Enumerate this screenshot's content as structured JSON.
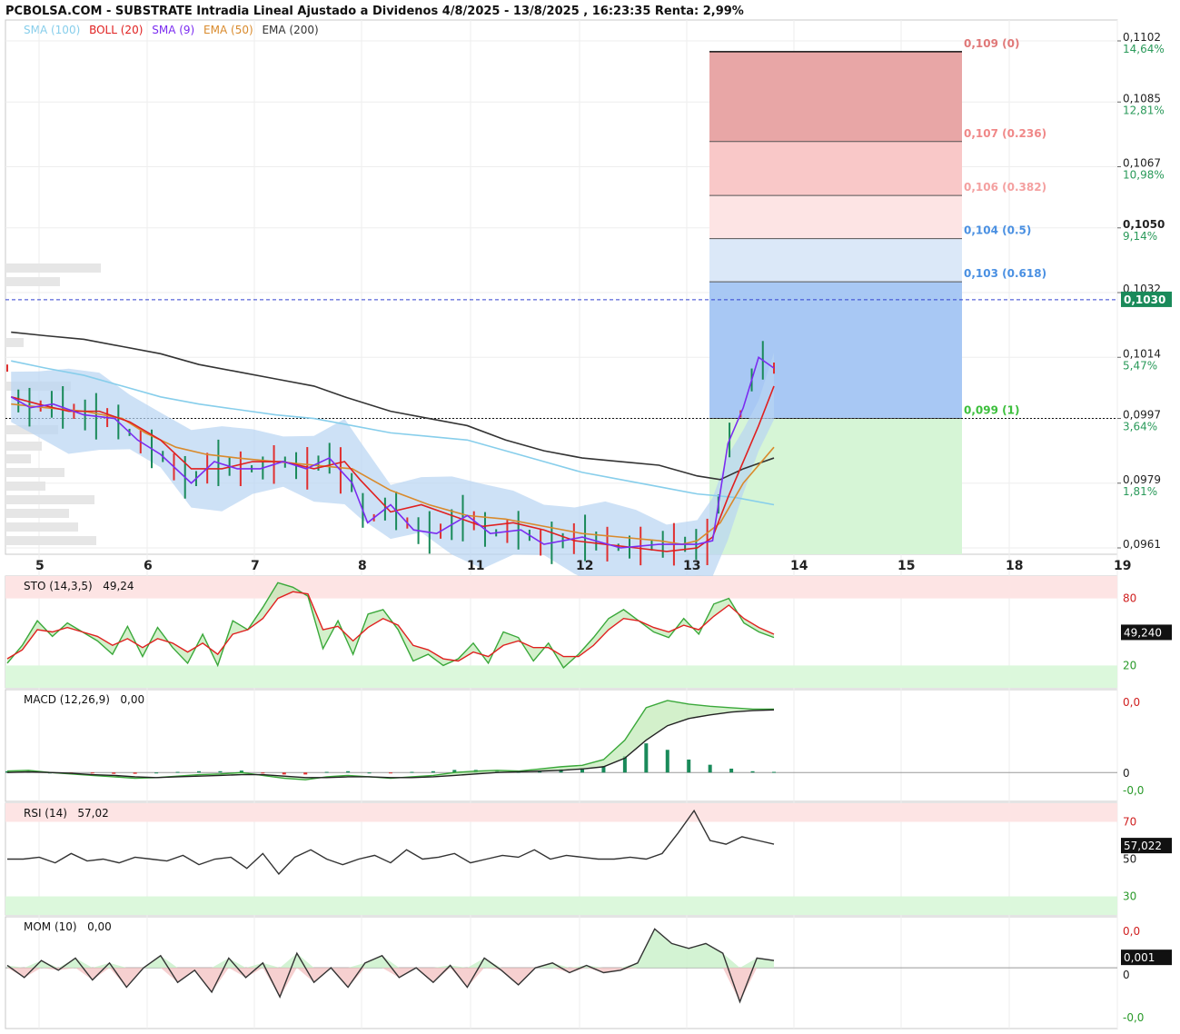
{
  "header": {
    "title": "PCBOLSA.COM - SUBSTRATE Intradia Lineal Ajustado a Dividenos 4/8/2025 - 13/8/2025 , 16:23:35 Renta: 2,99%"
  },
  "legend": [
    {
      "label": "SMA (100)",
      "color": "#87ceeb"
    },
    {
      "label": "BOLL (20)",
      "color": "#e02020"
    },
    {
      "label": "SMA (9)",
      "color": "#7b2cf0"
    },
    {
      "label": "EMA (50)",
      "color": "#d98a2c"
    },
    {
      "label": "EMA (200)",
      "color": "#333333"
    }
  ],
  "colors": {
    "up": "#1a8a5a",
    "down": "#e03030",
    "boll_band": "#b8d4f2",
    "fib_red_dark": "#e8a6a6",
    "fib_red_mid": "#f9c8c8",
    "fib_red_light": "#fde4e4",
    "fib_blue_light": "#dbe8f8",
    "fib_blue_dark": "#a8c8f4",
    "fib_green": "#d6f5d6",
    "price_tag": "#1a8a5a"
  },
  "chart_data": [
    {
      "type": "line",
      "panel": "price",
      "x_ticks": [
        "5",
        "6",
        "7",
        "8",
        "11",
        "12",
        "13",
        "14",
        "15",
        "18",
        "19"
      ],
      "y_ticks": [
        "0,1102",
        "0,1085",
        "0,1067",
        "0,1050",
        "0,1032",
        "0,1014",
        "0,0997",
        "0,0979",
        "0,0961"
      ],
      "y_ticks_bold": "0,1050",
      "pct_ticks": [
        "14,64%",
        "12,81%",
        "10,98%",
        "9,14%",
        "5,47%",
        "3,64%",
        "1,81%"
      ],
      "ylim": [
        0.0961,
        0.1102
      ],
      "last_price": "0,1030",
      "fibonacci": [
        {
          "label": "0,109 (0)",
          "value": 0.1099,
          "color": "#e07878"
        },
        {
          "label": "0,107 (0.236)",
          "value": 0.1074,
          "color": "#f08888"
        },
        {
          "label": "0,106 (0.382)",
          "value": 0.1059,
          "color": "#f4a0a0"
        },
        {
          "label": "0,104 (0.5)",
          "value": 0.1047,
          "color": "#4a90e2"
        },
        {
          "label": "0,103 (0.618)",
          "value": 0.1035,
          "color": "#4a90e2"
        },
        {
          "label": "0,099 (1)",
          "value": 0.0997,
          "color": "#3cbf3c"
        }
      ],
      "series": [
        {
          "name": "SMA (100)",
          "points": [
            [
              0.005,
              0.1013
            ],
            [
              0.05,
              0.1011
            ],
            [
              0.1,
              0.1009
            ],
            [
              0.15,
              0.1006
            ],
            [
              0.2,
              0.1003
            ],
            [
              0.25,
              0.1001
            ],
            [
              0.3,
              0.09995
            ],
            [
              0.35,
              0.0998
            ],
            [
              0.4,
              0.0997
            ],
            [
              0.45,
              0.0995
            ],
            [
              0.5,
              0.0993
            ],
            [
              0.55,
              0.0992
            ],
            [
              0.6,
              0.0991
            ],
            [
              0.65,
              0.0988
            ],
            [
              0.7,
              0.0985
            ],
            [
              0.75,
              0.0982
            ],
            [
              0.8,
              0.098
            ],
            [
              0.85,
              0.0978
            ],
            [
              0.9,
              0.0976
            ],
            [
              0.95,
              0.0975
            ],
            [
              1.0,
              0.0973
            ]
          ]
        },
        {
          "name": "EMA (200)",
          "points": [
            [
              0.005,
              0.1021
            ],
            [
              0.05,
              0.102
            ],
            [
              0.1,
              0.1019
            ],
            [
              0.15,
              0.1017
            ],
            [
              0.2,
              0.1015
            ],
            [
              0.25,
              0.1012
            ],
            [
              0.3,
              0.101
            ],
            [
              0.35,
              0.1008
            ],
            [
              0.4,
              0.1006
            ],
            [
              0.44,
              0.1003
            ],
            [
              0.5,
              0.0999
            ],
            [
              0.55,
              0.0997
            ],
            [
              0.6,
              0.0995
            ],
            [
              0.65,
              0.0991
            ],
            [
              0.7,
              0.0988
            ],
            [
              0.75,
              0.0986
            ],
            [
              0.8,
              0.0985
            ],
            [
              0.85,
              0.0984
            ],
            [
              0.9,
              0.0981
            ],
            [
              0.93,
              0.098
            ],
            [
              0.96,
              0.0983
            ],
            [
              1.0,
              0.0986
            ]
          ]
        },
        {
          "name": "EMA (50)",
          "points": [
            [
              0.005,
              0.1001
            ],
            [
              0.05,
              0.1
            ],
            [
              0.1,
              0.0999
            ],
            [
              0.15,
              0.0997
            ],
            [
              0.18,
              0.0993
            ],
            [
              0.22,
              0.0989
            ],
            [
              0.26,
              0.0987
            ],
            [
              0.3,
              0.0986
            ],
            [
              0.35,
              0.0985
            ],
            [
              0.4,
              0.0984
            ],
            [
              0.45,
              0.0983
            ],
            [
              0.5,
              0.0977
            ],
            [
              0.55,
              0.0973
            ],
            [
              0.6,
              0.097
            ],
            [
              0.65,
              0.0969
            ],
            [
              0.7,
              0.0967
            ],
            [
              0.75,
              0.0965
            ],
            [
              0.8,
              0.0964
            ],
            [
              0.85,
              0.0963
            ],
            [
              0.88,
              0.0962
            ],
            [
              0.9,
              0.0963
            ],
            [
              0.93,
              0.0968
            ],
            [
              0.96,
              0.0979
            ],
            [
              1.0,
              0.0989
            ]
          ]
        },
        {
          "name": "BOLL (20)",
          "points": [
            [
              0.005,
              0.1003
            ],
            [
              0.04,
              0.1001
            ],
            [
              0.08,
              0.0999
            ],
            [
              0.12,
              0.0999
            ],
            [
              0.16,
              0.0996
            ],
            [
              0.2,
              0.0991
            ],
            [
              0.24,
              0.0983
            ],
            [
              0.28,
              0.0983
            ],
            [
              0.32,
              0.0985
            ],
            [
              0.36,
              0.0985
            ],
            [
              0.4,
              0.0983
            ],
            [
              0.44,
              0.0985
            ],
            [
              0.46,
              0.098
            ],
            [
              0.5,
              0.0971
            ],
            [
              0.54,
              0.0973
            ],
            [
              0.58,
              0.097
            ],
            [
              0.62,
              0.0967
            ],
            [
              0.66,
              0.0968
            ],
            [
              0.7,
              0.0966
            ],
            [
              0.74,
              0.0963
            ],
            [
              0.78,
              0.0962
            ],
            [
              0.82,
              0.0961
            ],
            [
              0.86,
              0.096
            ],
            [
              0.9,
              0.0961
            ],
            [
              0.92,
              0.0964
            ],
            [
              0.94,
              0.0975
            ],
            [
              0.96,
              0.0985
            ],
            [
              0.98,
              0.0995
            ],
            [
              1.0,
              0.1006
            ]
          ]
        },
        {
          "name": "SMA (9)",
          "points": [
            [
              0.005,
              0.1003
            ],
            [
              0.03,
              0.1
            ],
            [
              0.06,
              0.1001
            ],
            [
              0.1,
              0.0998
            ],
            [
              0.14,
              0.0997
            ],
            [
              0.17,
              0.0991
            ],
            [
              0.2,
              0.0987
            ],
            [
              0.24,
              0.0979
            ],
            [
              0.27,
              0.0985
            ],
            [
              0.3,
              0.0983
            ],
            [
              0.33,
              0.0983
            ],
            [
              0.36,
              0.0985
            ],
            [
              0.39,
              0.0983
            ],
            [
              0.42,
              0.0986
            ],
            [
              0.45,
              0.0979
            ],
            [
              0.47,
              0.0968
            ],
            [
              0.5,
              0.0973
            ],
            [
              0.53,
              0.0966
            ],
            [
              0.56,
              0.0965
            ],
            [
              0.6,
              0.097
            ],
            [
              0.63,
              0.0965
            ],
            [
              0.67,
              0.0966
            ],
            [
              0.7,
              0.0962
            ],
            [
              0.75,
              0.0964
            ],
            [
              0.8,
              0.0961
            ],
            [
              0.85,
              0.0962
            ],
            [
              0.9,
              0.0962
            ],
            [
              0.92,
              0.0963
            ],
            [
              0.94,
              0.099
            ],
            [
              0.96,
              0.1
            ],
            [
              0.98,
              0.1014
            ],
            [
              1.0,
              0.1011
            ]
          ]
        }
      ]
    },
    {
      "type": "line",
      "panel": "STO",
      "label": "STO (14,3,5)",
      "value": "49,24",
      "last": "49,240",
      "levels": [
        "80",
        "20"
      ],
      "ylim": [
        0,
        100
      ],
      "k": [
        22,
        38,
        60,
        46,
        58,
        50,
        42,
        30,
        55,
        28,
        54,
        36,
        22,
        48,
        20,
        60,
        52,
        72,
        94,
        90,
        82,
        35,
        60,
        30,
        66,
        70,
        52,
        24,
        30,
        20,
        26,
        40,
        22,
        50,
        45,
        24,
        40,
        18,
        30,
        45,
        62,
        70,
        60,
        50,
        45,
        62,
        48,
        75,
        80,
        58,
        50,
        45
      ],
      "d": [
        26,
        34,
        52,
        50,
        54,
        50,
        46,
        38,
        44,
        36,
        44,
        40,
        32,
        40,
        30,
        48,
        52,
        62,
        80,
        86,
        84,
        52,
        55,
        42,
        54,
        62,
        56,
        38,
        34,
        26,
        24,
        32,
        28,
        38,
        42,
        36,
        36,
        28,
        28,
        38,
        52,
        62,
        60,
        54,
        50,
        56,
        52,
        64,
        74,
        62,
        54,
        48
      ]
    },
    {
      "type": "line",
      "panel": "MACD",
      "label": "MACD (12,26,9)",
      "value": "0,00",
      "ticks": [
        "0,0",
        "0",
        "-0,0"
      ],
      "macd": [
        0.02,
        0.03,
        0.0,
        -0.02,
        -0.04,
        -0.06,
        -0.08,
        -0.07,
        -0.05,
        -0.03,
        -0.02,
        0.0,
        -0.04,
        -0.08,
        -0.1,
        -0.06,
        -0.04,
        -0.06,
        -0.08,
        -0.06,
        -0.04,
        0.0,
        0.02,
        0.03,
        0.02,
        0.05,
        0.08,
        0.1,
        0.18,
        0.45,
        0.9,
        1.0,
        0.95,
        0.92,
        0.9,
        0.88,
        0.88
      ],
      "signal": [
        0.0,
        0.01,
        0.0,
        -0.01,
        -0.03,
        -0.04,
        -0.06,
        -0.07,
        -0.06,
        -0.05,
        -0.04,
        -0.03,
        -0.03,
        -0.05,
        -0.07,
        -0.07,
        -0.06,
        -0.06,
        -0.07,
        -0.07,
        -0.06,
        -0.04,
        -0.02,
        0.0,
        0.01,
        0.02,
        0.03,
        0.05,
        0.08,
        0.2,
        0.45,
        0.65,
        0.75,
        0.8,
        0.84,
        0.86,
        0.87
      ]
    },
    {
      "type": "line",
      "panel": "RSI",
      "label": "RSI (14)",
      "value": "57,02",
      "last": "57,022",
      "levels": [
        "70",
        "50",
        "30"
      ],
      "ylim": [
        20,
        80
      ],
      "values": [
        50,
        50,
        51,
        48,
        53,
        49,
        50,
        48,
        51,
        50,
        49,
        52,
        47,
        50,
        51,
        45,
        53,
        42,
        51,
        55,
        50,
        47,
        50,
        52,
        48,
        55,
        50,
        51,
        53,
        48,
        50,
        52,
        51,
        55,
        50,
        52,
        51,
        50,
        50,
        51,
        50,
        53,
        64,
        76,
        60,
        58,
        62,
        60,
        58
      ]
    },
    {
      "type": "line",
      "panel": "MOM",
      "label": "MOM (10)",
      "value": "0,00",
      "last": "0,001",
      "ticks": [
        "0,0",
        "0",
        "-0,0"
      ],
      "ylim": [
        -1,
        1
      ],
      "values": [
        0.15,
        -0.1,
        0.25,
        0.05,
        0.3,
        -0.15,
        0.2,
        -0.3,
        0.1,
        0.35,
        -0.2,
        0.05,
        -0.4,
        0.3,
        -0.1,
        0.2,
        -0.5,
        0.4,
        -0.2,
        0.1,
        -0.3,
        0.2,
        0.35,
        -0.1,
        0.1,
        -0.2,
        0.15,
        -0.3,
        0.3,
        0.05,
        -0.25,
        0.1,
        0.2,
        0.0,
        0.15,
        0.0,
        0.05,
        0.2,
        0.9,
        0.6,
        0.5,
        0.6,
        0.4,
        -0.6,
        0.3,
        0.25
      ]
    }
  ]
}
